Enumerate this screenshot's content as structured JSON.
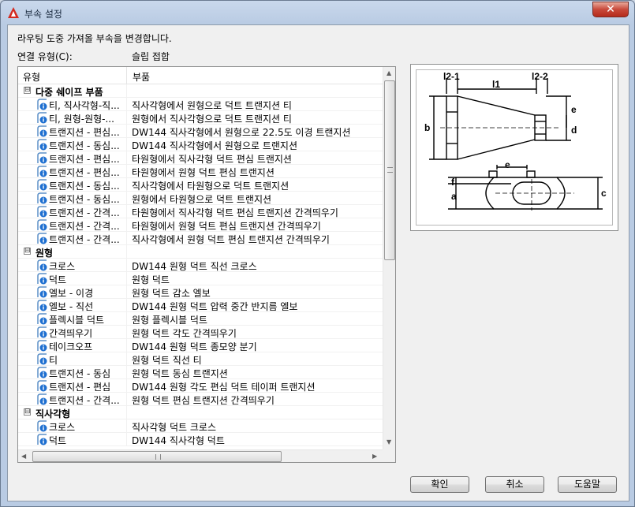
{
  "window": {
    "title": "부속 설정",
    "close_label": "✕"
  },
  "description": "라우팅 도중 가져올 부속을 변경합니다.",
  "connection": {
    "label": "연결 유형(C):",
    "value": "슬립 접합"
  },
  "list": {
    "headers": {
      "type": "유형",
      "part": "부품"
    },
    "groups": [
      {
        "name": "다중 쉐이프 부품",
        "toggle": "⊟",
        "items": [
          {
            "type": "티, 직사각형-직...",
            "part": "직사각형에서 원형으로 덕트 트랜지션 티"
          },
          {
            "type": "티, 원형-원형-...",
            "part": "원형에서 직사각형으로 덕트 트랜지션 티"
          },
          {
            "type": "트랜지션 - 편심...",
            "part": "DW144 직사각형에서 원형으로 22.5도 이경 트랜지션"
          },
          {
            "type": "트랜지션 - 동심...",
            "part": "DW144 직사각형에서 원형으로 트랜지션"
          },
          {
            "type": "트랜지션 - 편심...",
            "part": "타원형에서 직사각형 덕트 편심 트랜지션"
          },
          {
            "type": "트랜지션 - 편심...",
            "part": "타원형에서 원형 덕트 편심 트랜지션"
          },
          {
            "type": "트랜지션 - 동심...",
            "part": "직사각형에서 타원형으로 덕트 트랜지션"
          },
          {
            "type": "트랜지션 - 동심...",
            "part": "원형에서 타원형으로 덕트 트랜지션"
          },
          {
            "type": "트랜지션 - 간격...",
            "part": "타원형에서 직사각형 덕트 편심 트랜지션 간격띄우기"
          },
          {
            "type": "트랜지션 - 간격...",
            "part": "타원형에서 원형 덕트 편심 트랜지션 간격띄우기"
          },
          {
            "type": "트랜지션 - 간격...",
            "part": "직사각형에서 원형 덕트 편심 트랜지션 간격띄우기"
          }
        ]
      },
      {
        "name": "원형",
        "toggle": "⊟",
        "items": [
          {
            "type": "크로스",
            "part": "DW144 원형 덕트 직선 크로스"
          },
          {
            "type": "덕트",
            "part": "원형 덕트"
          },
          {
            "type": "엘보 - 이경",
            "part": "원형 덕트 감소 엘보"
          },
          {
            "type": "엘보 - 직선",
            "part": "DW144 원형 덕트 압력 중간 반지름 엘보"
          },
          {
            "type": "플렉시블 덕트",
            "part": "원형 플렉시블 덕트"
          },
          {
            "type": "간격띄우기",
            "part": "원형 덕트 각도 간격띄우기"
          },
          {
            "type": "테이크오프",
            "part": "DW144 원형 덕트 종모양 분기"
          },
          {
            "type": "티",
            "part": "원형 덕트 직선 티"
          },
          {
            "type": "트랜지션 - 동심",
            "part": "원형 덕트 동심 트랜지션"
          },
          {
            "type": "트랜지션 - 편심",
            "part": "DW144 원형 각도 편심 덕트 테이퍼 트랜지션"
          },
          {
            "type": "트랜지션 - 간격...",
            "part": "원형 덕트 편심 트랜지션 간격띄우기"
          }
        ]
      },
      {
        "name": "직사각형",
        "toggle": "⊟",
        "items": [
          {
            "type": "크로스",
            "part": "직사각형 덕트 크로스"
          },
          {
            "type": "덕트",
            "part": "DW144 직사각형 덕트"
          }
        ]
      }
    ],
    "scroll_arrows": {
      "up": "▲",
      "down": "▼",
      "left": "◀",
      "right": "▶"
    }
  },
  "preview": {
    "labels": {
      "l2_1": "l2-1",
      "l1": "l1",
      "l2_2": "l2-2",
      "b": "b",
      "e_top": "e",
      "d": "d",
      "e_bottom": "e",
      "f": "f",
      "a": "a",
      "c": "c"
    }
  },
  "buttons": {
    "ok": "확인",
    "cancel": "취소",
    "help": "도움말"
  },
  "colors": {
    "accent": "#1e6fd0",
    "title_bg": "#c9d8ec",
    "close": "#c8493a"
  }
}
